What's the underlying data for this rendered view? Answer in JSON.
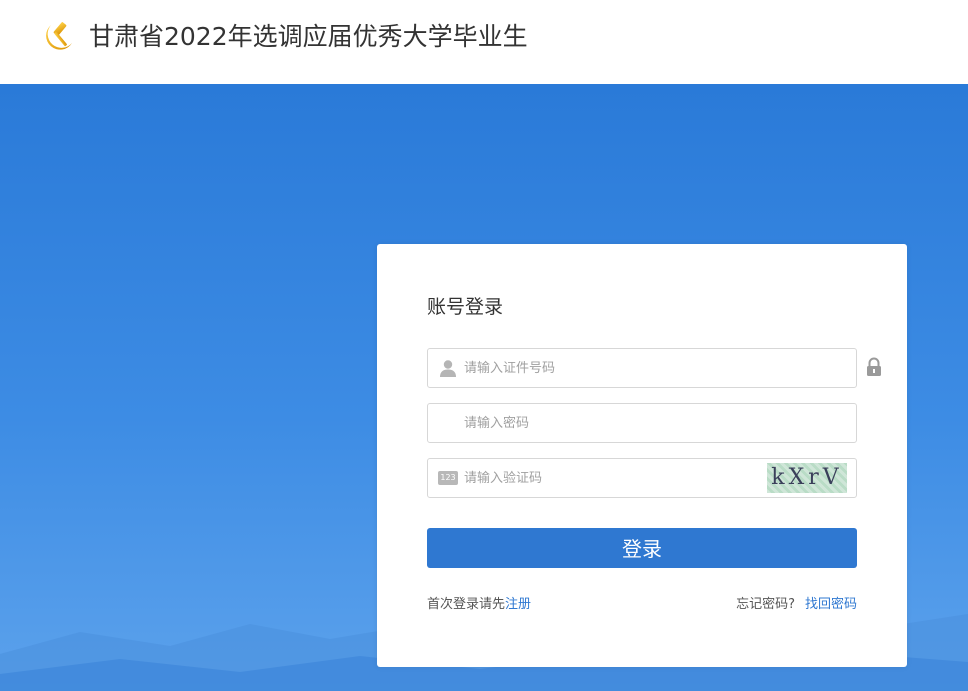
{
  "header": {
    "logo_icon": "party-emblem-icon",
    "title": "甘肃省2022年选调应届优秀大学毕业生"
  },
  "login": {
    "title": "账号登录",
    "id_field": {
      "placeholder": "请输入证件号码",
      "value": "",
      "icon": "user-icon"
    },
    "password_field": {
      "placeholder": "请输入密码",
      "value": ""
    },
    "captcha_field": {
      "placeholder": "请输入验证码",
      "value": "",
      "badge": "123",
      "captcha_text": "kXrV"
    },
    "lock_icon": "lock-icon",
    "submit_label": "登录",
    "register_prompt": "首次登录请先",
    "register_link": "注册",
    "forgot_prompt": "忘记密码?",
    "recover_link": "找回密码"
  },
  "colors": {
    "primary": "#2f78d1",
    "hero_top": "#2a7ad8",
    "hero_bottom": "#5ca2ec",
    "emblem": "#f0b400"
  }
}
